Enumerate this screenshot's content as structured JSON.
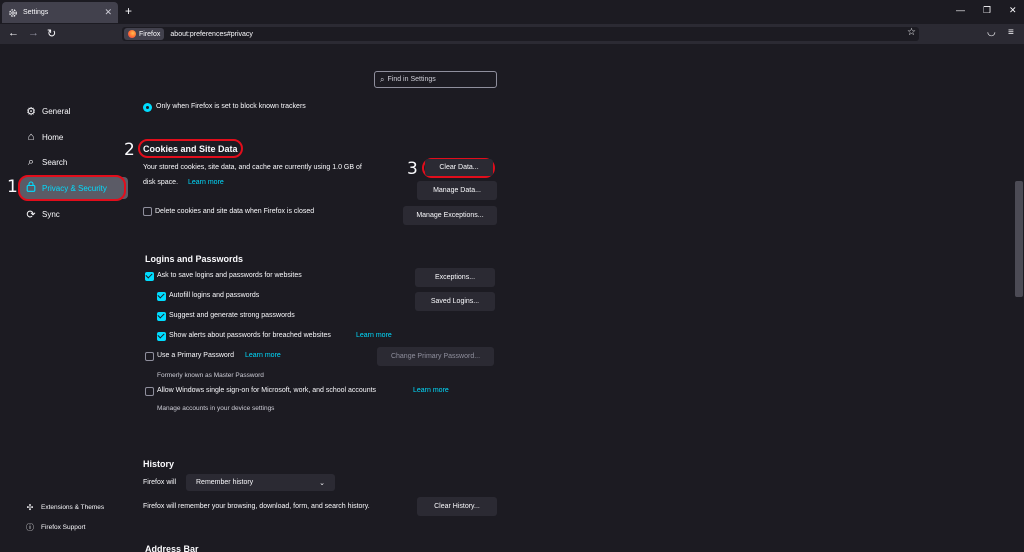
{
  "tab": {
    "title": "Settings"
  },
  "url": {
    "identity": "Firefox",
    "address": "about:preferences#privacy"
  },
  "search": {
    "placeholder": "Find in Settings"
  },
  "sidebar": {
    "items": [
      {
        "label": "General",
        "icon": "gear-icon"
      },
      {
        "label": "Home",
        "icon": "home-icon"
      },
      {
        "label": "Search",
        "icon": "search-icon"
      },
      {
        "label": "Privacy & Security",
        "icon": "lock-icon"
      },
      {
        "label": "Sync",
        "icon": "sync-icon"
      }
    ],
    "footer": [
      {
        "label": "Extensions & Themes",
        "icon": "puzzle-icon"
      },
      {
        "label": "Firefox Support",
        "icon": "help-icon"
      }
    ]
  },
  "annotations": [
    "1",
    "2",
    "3"
  ],
  "tracking": {
    "radio_label": "Only when Firefox is set to block known trackers"
  },
  "cookies": {
    "title": "Cookies and Site Data",
    "desc1": "Your stored cookies, site data, and cache are currently using 1.0 GB of",
    "desc2": "disk space.",
    "learn_more": "Learn more",
    "delete_label": "Delete cookies and site data when Firefox is closed",
    "clear_btn": "Clear Data...",
    "manage_btn": "Manage Data...",
    "exceptions_btn": "Manage Exceptions..."
  },
  "logins": {
    "title": "Logins and Passwords",
    "ask_save": "Ask to save logins and passwords for websites",
    "autofill": "Autofill logins and passwords",
    "suggest": "Suggest and generate strong passwords",
    "alerts": "Show alerts about passwords for breached websites",
    "alerts_link": "Learn more",
    "primary": "Use a Primary Password",
    "primary_link": "Learn more",
    "formerly": "Formerly known as Master Password",
    "sso": "Allow Windows single sign-on for Microsoft, work, and school accounts",
    "sso_link": "Learn more",
    "sso_note": "Manage accounts in your device settings",
    "exceptions_btn": "Exceptions...",
    "saved_btn": "Saved Logins...",
    "change_btn": "Change Primary Password..."
  },
  "history": {
    "title": "History",
    "will_label": "Firefox will",
    "select_value": "Remember history",
    "desc": "Firefox will remember your browsing, download, form, and search history.",
    "clear_btn": "Clear History..."
  },
  "next_section": {
    "title": "Address Bar"
  },
  "colors": {
    "accent": "#00ddff",
    "annotation": "#e20d1b",
    "background": "#1c1b22"
  }
}
